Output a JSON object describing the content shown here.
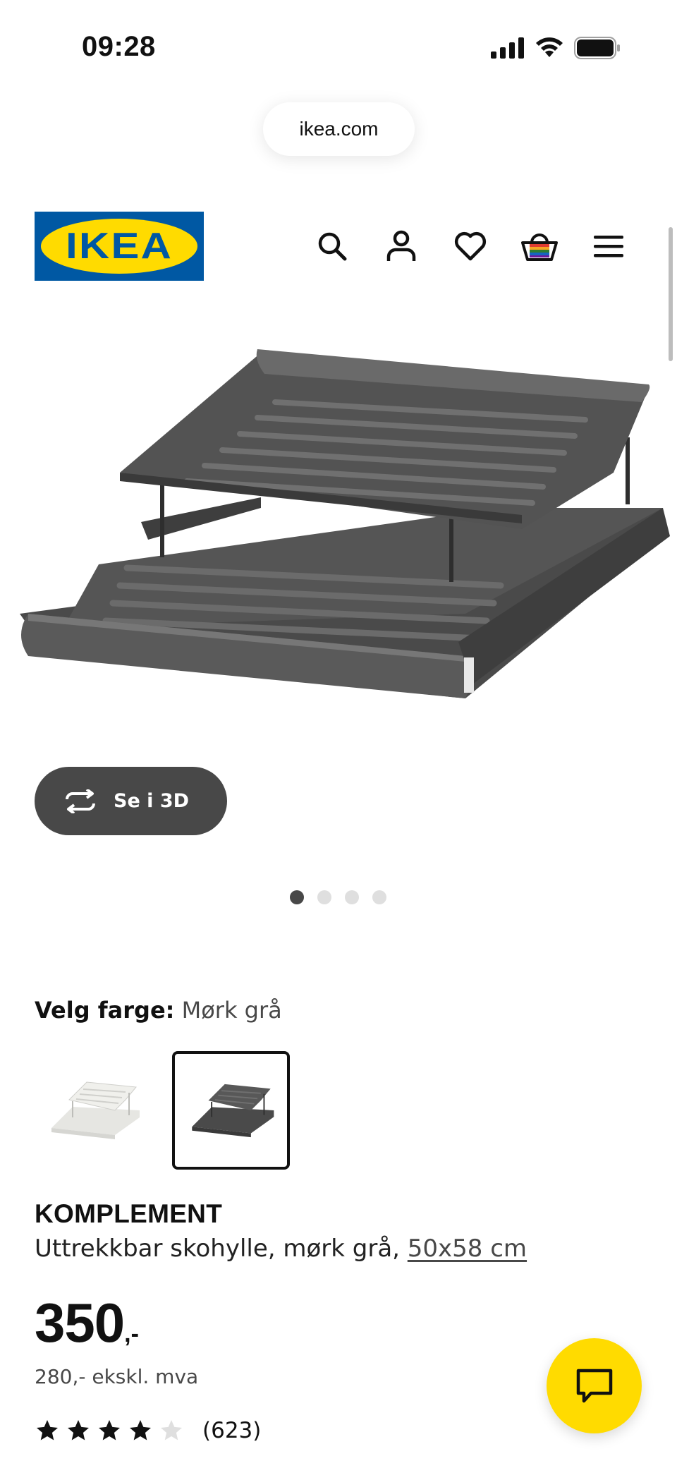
{
  "status_bar": {
    "time": "09:28"
  },
  "browser": {
    "url": "ikea.com"
  },
  "header": {
    "logo_text": "IKEA",
    "icons": [
      "search-icon",
      "user-icon",
      "heart-icon",
      "basket-icon",
      "menu-icon"
    ]
  },
  "gallery": {
    "view_3d_label": "Se i 3D",
    "image_count": 4,
    "active_index": 0
  },
  "color_picker": {
    "label": "Velg farge:",
    "selected_value": "Mørk grå",
    "options": [
      {
        "color": "#f2f2f0",
        "selected": false
      },
      {
        "color": "#4a4a4a",
        "selected": true
      }
    ]
  },
  "product": {
    "name": "KOMPLEMENT",
    "description": "Uttrekkbar skohylle, mørk grå,",
    "size_link": "50x58 cm",
    "price_main": "350",
    "price_suffix": ",-",
    "price_ex_vat": "280,- ekskl. mva",
    "rating": 4,
    "rating_max": 5,
    "review_count": "(623)"
  },
  "colors": {
    "ikea_blue": "#0058a3",
    "ikea_yellow": "#ffdb00",
    "button_dark": "#484848"
  }
}
